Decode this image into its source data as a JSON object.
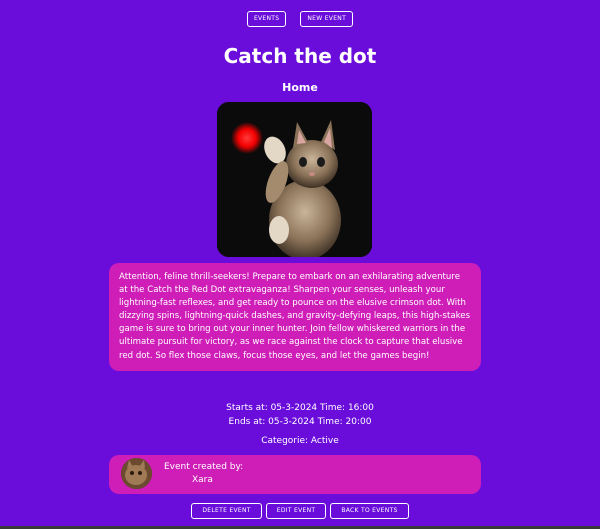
{
  "nav": {
    "events_label": "EVENTS",
    "new_event_label": "NEW EVENT"
  },
  "event": {
    "title": "Catch the dot",
    "location": "Home",
    "description": "Attention, feline thrill-seekers! Prepare to embark on an exhilarating adventure at the Catch the Red Dot extravaganza! Sharpen your senses, unleash your lightning-fast reflexes, and get ready to pounce on the elusive crimson dot. With dizzying spins, lightning-quick dashes, and gravity-defying leaps, this high-stakes game is sure to bring out your inner hunter. Join fellow whiskered warriors in the ultimate pursuit for victory, as we race against the clock to capture that elusive red dot. So flex those claws, focus those eyes, and let the games begin!",
    "starts": "Starts at: 05-3-2024 Time: 16:00",
    "ends": "Ends at:  05-3-2024 Time:  20:00",
    "category": "Categorie: Active",
    "creator_label": "Event created by:",
    "creator_name": "Xara"
  },
  "actions": {
    "delete_label": "DELETE EVENT",
    "edit_label": "EDIT EVENT",
    "back_label": "BACK TO EVENTS"
  },
  "colors": {
    "background": "#6a0ddb",
    "card": "#cf1eb8",
    "laser_dot": "#ff1a1a"
  }
}
